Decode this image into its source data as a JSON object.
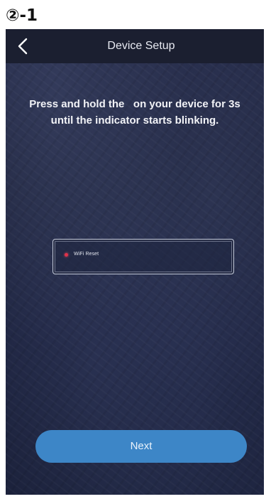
{
  "step_label": "②-1",
  "nav": {
    "title": "Device Setup",
    "back_icon": "chevron-left-icon"
  },
  "instruction": {
    "line1": "Press and hold the   on your device for 3s",
    "line2": "until the indicator starts blinking."
  },
  "panel": {
    "label": "WiFi Reset",
    "indicator_color": "#e0324a"
  },
  "next_button": {
    "label": "Next"
  },
  "colors": {
    "nav_bar": "#1b1f30",
    "background": "#20263f",
    "button": "#3d86c7"
  }
}
